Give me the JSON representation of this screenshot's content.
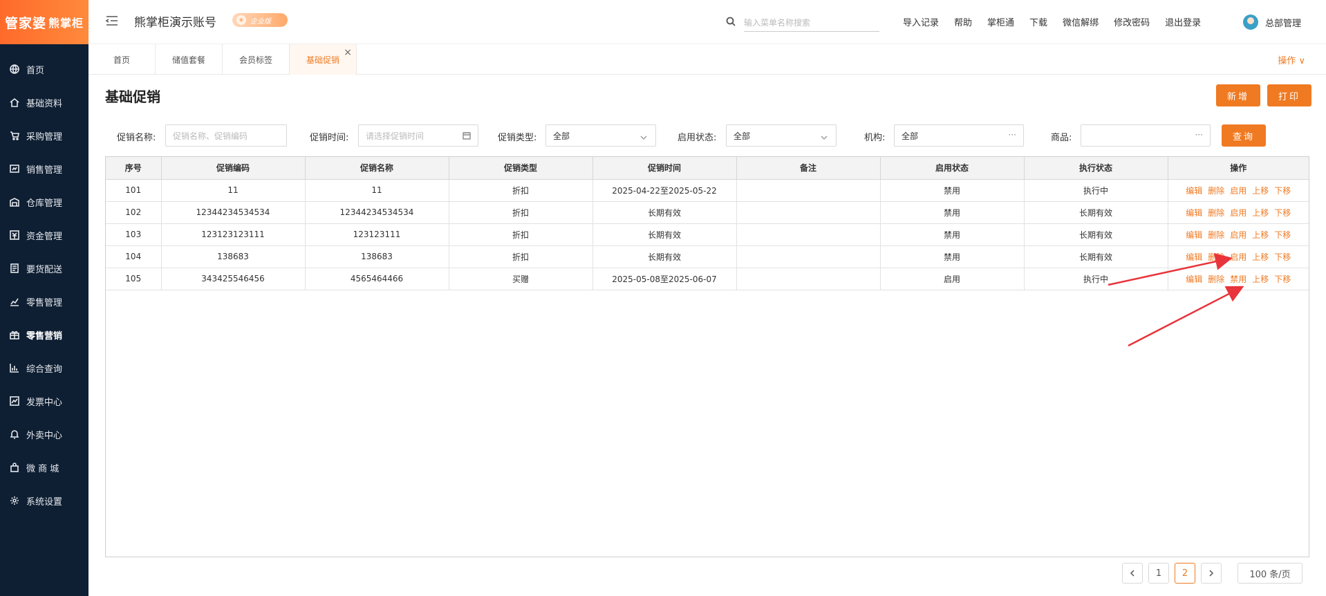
{
  "logo": {
    "main": "管家婆",
    "sub": "熊掌柜"
  },
  "sidebar": {
    "items": [
      {
        "label": "首页",
        "icon": "globe-icon"
      },
      {
        "label": "基础资料",
        "icon": "home-icon"
      },
      {
        "label": "采购管理",
        "icon": "cart-icon"
      },
      {
        "label": "销售管理",
        "icon": "sales-icon"
      },
      {
        "label": "仓库管理",
        "icon": "warehouse-icon"
      },
      {
        "label": "资金管理",
        "icon": "money-icon"
      },
      {
        "label": "要货配送",
        "icon": "list-icon"
      },
      {
        "label": "零售管理",
        "icon": "chart-icon"
      },
      {
        "label": "零售营销",
        "icon": "gift-icon"
      },
      {
        "label": "综合查询",
        "icon": "bar-chart-icon"
      },
      {
        "label": "发票中心",
        "icon": "line-chart-icon"
      },
      {
        "label": "外卖中心",
        "icon": "bell-icon"
      },
      {
        "label": "微 商 城",
        "icon": "bag-icon"
      },
      {
        "label": "系统设置",
        "icon": "gear-icon"
      }
    ],
    "active_index": 8
  },
  "header": {
    "account": "熊掌柜演示账号",
    "edition": "企业版",
    "search_placeholder": "输入菜单名称搜索",
    "links": [
      "导入记录",
      "帮助",
      "掌柜通",
      "下载",
      "微信解绑",
      "修改密码",
      "退出登录"
    ],
    "user": "总部管理"
  },
  "tabs": {
    "items": [
      "首页",
      "储值套餐",
      "会员标签",
      "基础促销"
    ],
    "active_index": 3,
    "close": "×",
    "ops": "操作 ∨"
  },
  "page": {
    "title": "基础促销",
    "add_button": "新增",
    "print_button": "打印",
    "query_button": "查询"
  },
  "filters": {
    "name_label": "促销名称:",
    "name_placeholder": "促销名称、促销编码",
    "time_label": "促销时间:",
    "time_placeholder": "请选择促销时间",
    "type_label": "促销类型:",
    "type_value": "全部",
    "status_label": "启用状态:",
    "status_value": "全部",
    "org_label": "机构:",
    "org_value": "全部",
    "goods_label": "商品:",
    "goods_value": "",
    "more": "···"
  },
  "table": {
    "columns": [
      "序号",
      "促销编码",
      "促销名称",
      "促销类型",
      "促销时间",
      "备注",
      "启用状态",
      "执行状态",
      "操作"
    ],
    "rows": [
      {
        "no": "101",
        "code": "11",
        "name": "11",
        "type": "折扣",
        "time": "2025-04-22至2025-05-22",
        "remark": "",
        "enabled": "禁用",
        "exec": "执行中",
        "toggle": "启用"
      },
      {
        "no": "102",
        "code": "12344234534534",
        "name": "12344234534534",
        "type": "折扣",
        "time": "长期有效",
        "remark": "",
        "enabled": "禁用",
        "exec": "长期有效",
        "toggle": "启用"
      },
      {
        "no": "103",
        "code": "123123123111",
        "name": "123123111",
        "type": "折扣",
        "time": "长期有效",
        "remark": "",
        "enabled": "禁用",
        "exec": "长期有效",
        "toggle": "启用"
      },
      {
        "no": "104",
        "code": "138683",
        "name": "138683",
        "type": "折扣",
        "time": "长期有效",
        "remark": "",
        "enabled": "禁用",
        "exec": "长期有效",
        "toggle": "启用"
      },
      {
        "no": "105",
        "code": "343425546456",
        "name": "4565464466",
        "type": "买赠",
        "time": "2025-05-08至2025-06-07",
        "remark": "",
        "enabled": "启用",
        "exec": "执行中",
        "toggle": "禁用"
      }
    ],
    "actions": {
      "edit": "编辑",
      "delete": "删除",
      "up": "上移",
      "down": "下移"
    }
  },
  "pagination": {
    "pages": [
      "1",
      "2"
    ],
    "current": "2",
    "page_size": "100 条/页"
  },
  "colors": {
    "accent": "#f07a22",
    "sidebar": "#0e1f33",
    "arrow": "#e8343a"
  }
}
